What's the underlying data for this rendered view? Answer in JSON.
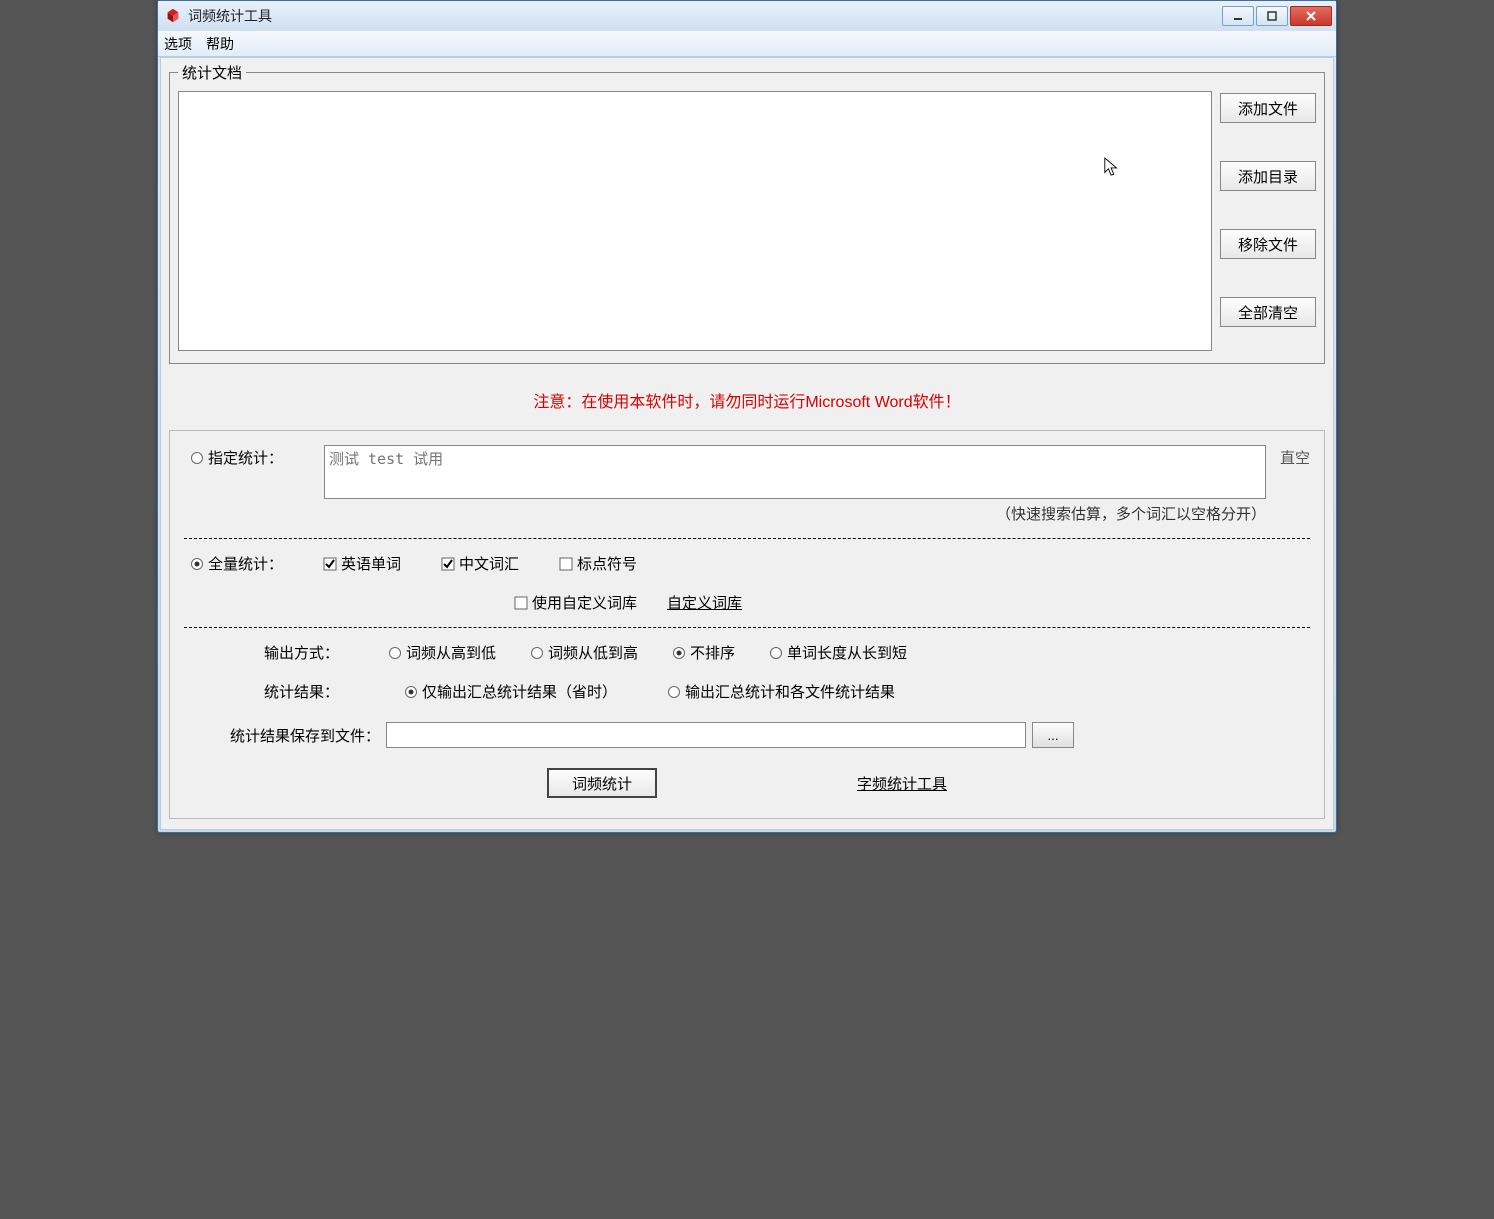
{
  "titlebar": {
    "title": "词频统计工具"
  },
  "menu": {
    "options": "选项",
    "help": "帮助"
  },
  "docs": {
    "legend": "统计文档",
    "buttons": {
      "add_file": "添加文件",
      "add_dir": "添加目录",
      "remove": "移除文件",
      "clear_all": "全部清空"
    }
  },
  "warning": "注意：在使用本软件时，请勿同时运行Microsoft Word软件！",
  "specify": {
    "radio_label": "指定统计：",
    "placeholder": "测试 test 试用",
    "clear": "直空",
    "hint": "（快速搜索估算，多个词汇以空格分开）"
  },
  "full": {
    "radio_label": "全量统计：",
    "english": "英语单词",
    "chinese": "中文词汇",
    "punct": "标点符号",
    "custom_cb": "使用自定义词库",
    "custom_link": "自定义词库"
  },
  "output": {
    "mode_label": "输出方式：",
    "mode_high_low": "词频从高到低",
    "mode_low_high": "词频从低到高",
    "mode_none": "不排序",
    "mode_len": "单词长度从长到短",
    "result_label": "统计结果：",
    "result_summary": "仅输出汇总统计结果（省时）",
    "result_full": "输出汇总统计和各文件统计结果",
    "save_label": "统计结果保存到文件：",
    "browse": "..."
  },
  "bottom": {
    "run": "词频统计",
    "char_tool": "字频统计工具"
  }
}
